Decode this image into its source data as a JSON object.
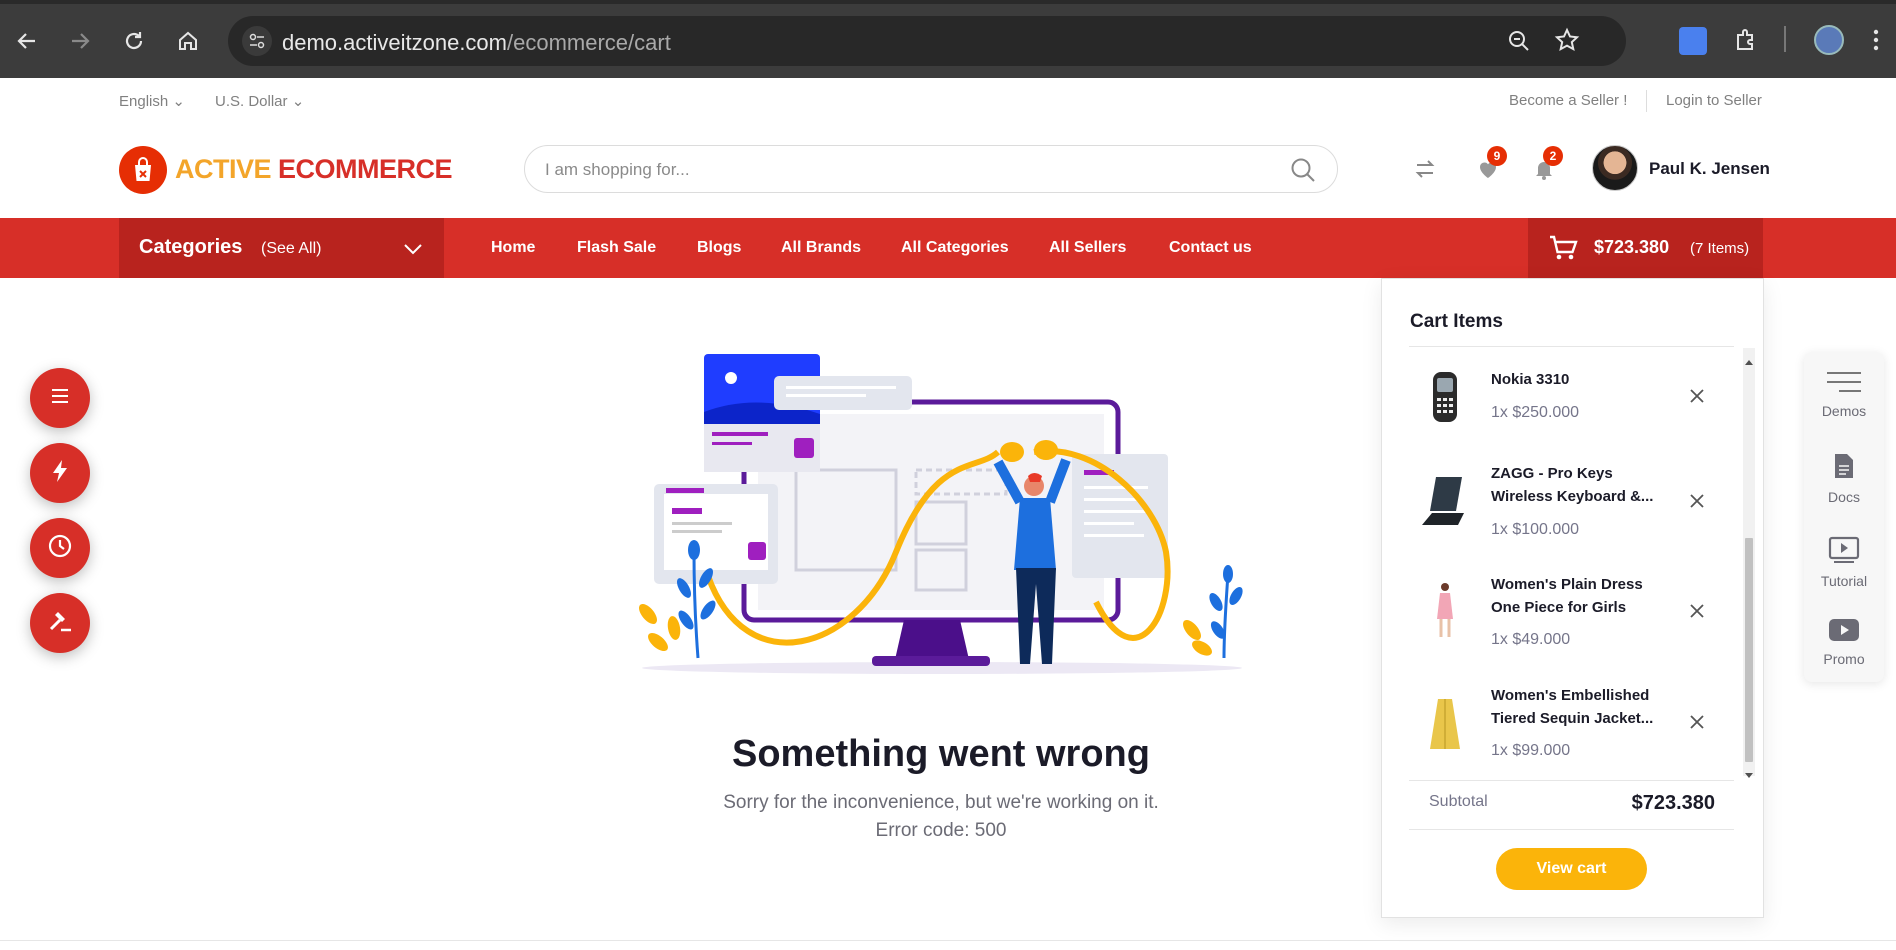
{
  "browser": {
    "url_host": "demo.activeitzone.com",
    "url_path": "/ecommerce/cart"
  },
  "topbar": {
    "language": "English",
    "currency": "U.S. Dollar",
    "become_seller": "Become a Seller !",
    "login_seller": "Login to Seller"
  },
  "header": {
    "logo_word1": "ACTIVE",
    "logo_word2": "ECOMMERCE",
    "search_placeholder": "I am shopping for...",
    "wishlist_count": "9",
    "notification_count": "2",
    "user_name": "Paul K. Jensen"
  },
  "navbar": {
    "categories_label": "Categories",
    "see_all": "(See All)",
    "links": [
      "Home",
      "Flash Sale",
      "Blogs",
      "All Brands",
      "All Categories",
      "All Sellers",
      "Contact us"
    ],
    "cart_total": "$723.380",
    "cart_items": "(7 Items)"
  },
  "error": {
    "title": "Something went wrong",
    "message": "Sorry for the inconvenience, but we're working on it.",
    "code": "Error code: 500"
  },
  "cart_panel": {
    "title": "Cart Items",
    "items": [
      {
        "name": "Nokia 3310",
        "price": "1x $250.000"
      },
      {
        "name": "ZAGG - Pro Keys Wireless Keyboard &...",
        "price": "1x $100.000"
      },
      {
        "name": "Women's Plain Dress One Piece for Girls",
        "price": "1x $49.000"
      },
      {
        "name": "Women's Embellished Tiered Sequin Jacket...",
        "price": "1x $99.000"
      }
    ],
    "subtotal_label": "Subtotal",
    "subtotal_value": "$723.380",
    "view_cart": "View cart"
  },
  "side_panel": {
    "items": [
      "Demos",
      "Docs",
      "Tutorial",
      "Promo"
    ]
  },
  "colors": {
    "brand_red": "#d72f28",
    "brand_yellow": "#fbb40a"
  }
}
